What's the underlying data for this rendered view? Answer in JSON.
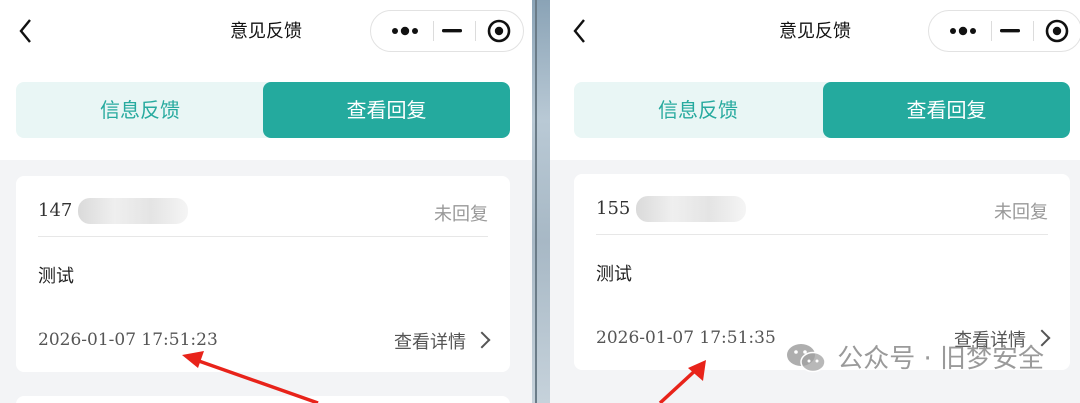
{
  "left": {
    "nav": {
      "title": "意见反馈"
    },
    "tabs": [
      {
        "label": "信息反馈",
        "active": false
      },
      {
        "label": "查看回复",
        "active": true
      }
    ],
    "card": {
      "phone": "147",
      "status": "未回复",
      "content": "测试",
      "time": "2026-01-07 17:51:23",
      "detail_label": "查看详情"
    }
  },
  "right": {
    "nav": {
      "title": "意见反馈"
    },
    "tabs": [
      {
        "label": "信息反馈",
        "active": false
      },
      {
        "label": "查看回复",
        "active": true
      }
    ],
    "card": {
      "phone": "155",
      "status": "未回复",
      "content": "测试",
      "time": "2026-01-07 17:51:35",
      "detail_label": "查看详情"
    }
  },
  "watermark": {
    "text": "公众号 · 旧梦安全"
  },
  "colors": {
    "accent": "#24aa9e",
    "accent_light": "#e9f6f5",
    "annotation_arrow": "#e8231a"
  },
  "icons": [
    "back-chevron-icon",
    "more-dots-icon",
    "minimize-icon",
    "target-icon",
    "chevron-right-icon",
    "wechat-icon"
  ]
}
